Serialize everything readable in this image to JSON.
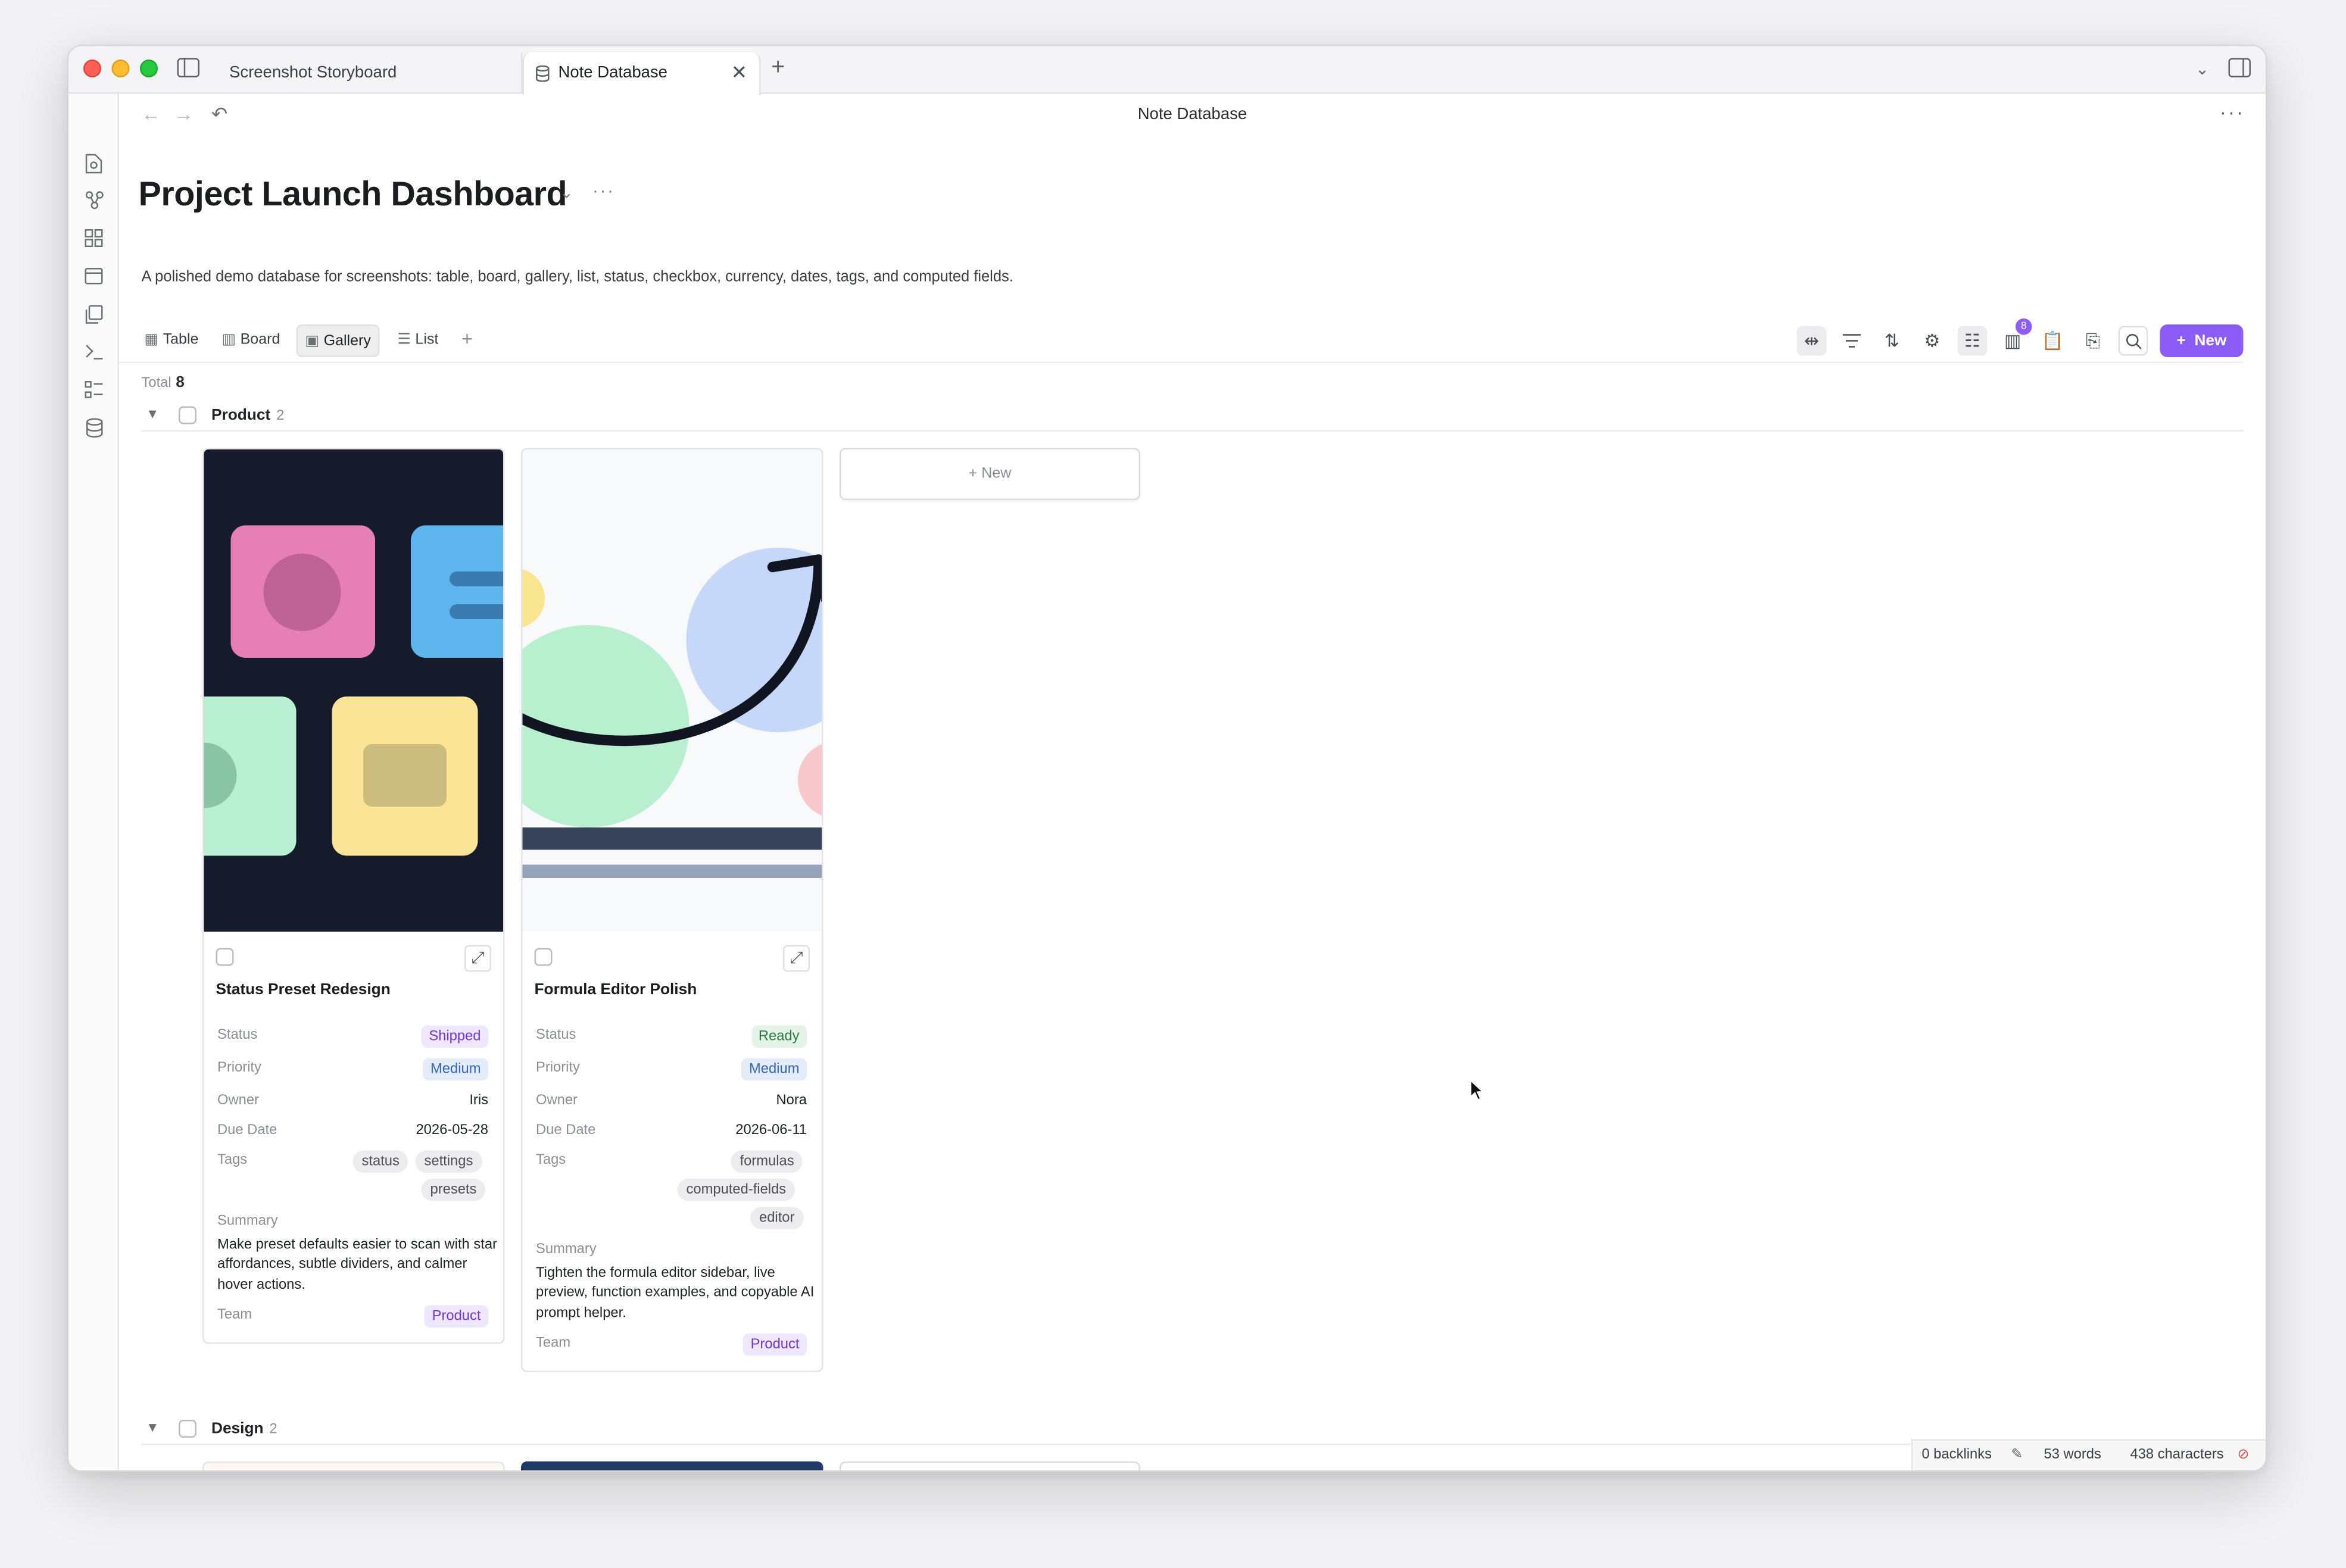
{
  "tabs": [
    {
      "label": "Screenshot Storyboard"
    },
    {
      "label": "Note Database",
      "active": true
    }
  ],
  "header": {
    "doc_title": "Note Database"
  },
  "database": {
    "title": "Project Launch Dashboard",
    "description": "A polished demo database for screenshots: table, board, gallery, list, status, checkbox, currency, dates, tags, and computed fields."
  },
  "views": [
    {
      "label": "Table",
      "icon": "table-icon"
    },
    {
      "label": "Board",
      "icon": "board-icon"
    },
    {
      "label": "Gallery",
      "icon": "gallery-icon",
      "active": true
    },
    {
      "label": "List",
      "icon": "list-icon"
    }
  ],
  "toolbar": {
    "new_label": "New",
    "properties_badge": "8"
  },
  "total": {
    "label": "Total",
    "value": "8"
  },
  "labels": {
    "status": "Status",
    "priority": "Priority",
    "owner": "Owner",
    "due_date": "Due Date",
    "tags": "Tags",
    "summary": "Summary",
    "team": "Team",
    "add_new": "+ New"
  },
  "groups": [
    {
      "name": "Product",
      "count": "2",
      "cards": [
        {
          "title": "Status Preset Redesign",
          "status": "Shipped",
          "priority": "Medium",
          "owner": "Iris",
          "due_date": "2026-05-28",
          "tags": [
            "status",
            "settings",
            "presets"
          ],
          "summary": "Make preset defaults easier to scan with star affordances, subtle dividers, and calmer hover actions.",
          "team": "Product"
        },
        {
          "title": "Formula Editor Polish",
          "status": "Ready",
          "priority": "Medium",
          "owner": "Nora",
          "due_date": "2026-06-11",
          "tags": [
            "formulas",
            "computed-fields",
            "editor"
          ],
          "summary": "Tighten the formula editor sidebar, live preview, function examples, and copyable AI prompt helper.",
          "team": "Product"
        }
      ]
    },
    {
      "name": "Design",
      "count": "2"
    }
  ],
  "footer": {
    "backlinks": "0 backlinks",
    "words": "53 words",
    "characters": "438 characters"
  },
  "colors": {
    "accent": "#8b5cf6",
    "status_shipped": "#6d37d8",
    "status_ready": "#2f7a44",
    "priority_medium": "#3565b9"
  }
}
